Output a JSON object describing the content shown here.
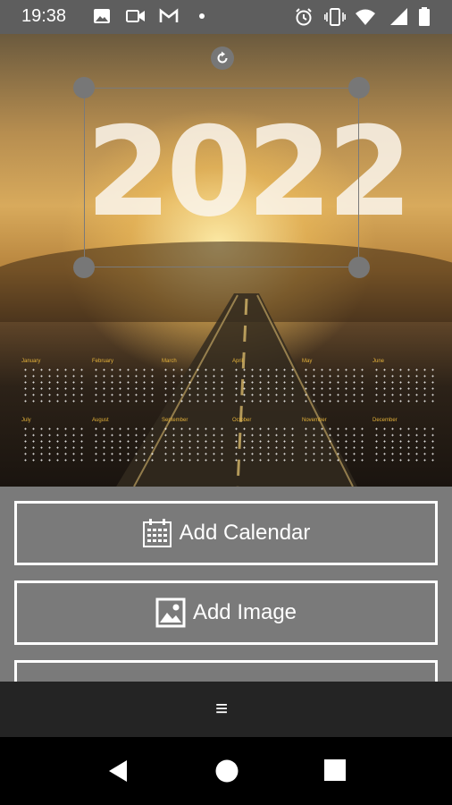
{
  "status_bar": {
    "time": "19:38",
    "icons": [
      "image-icon",
      "video-icon",
      "gmail-icon",
      "dot-icon",
      "alarm-icon",
      "vibrate-icon",
      "wifi-icon",
      "signal-icon",
      "battery-icon"
    ]
  },
  "canvas": {
    "year_text": "2022",
    "months": [
      "January",
      "February",
      "March",
      "April",
      "May",
      "June",
      "July",
      "August",
      "September",
      "October",
      "November",
      "December"
    ]
  },
  "buttons": {
    "add_calendar": "Add Calendar",
    "add_image": "Add Image"
  },
  "bottom_bar": {
    "menu": "≡"
  },
  "colors": {
    "panel": "#7a7a7a",
    "status_bar": "#5e5e5e",
    "bottom_bar": "#242424",
    "month_label": "#e4b23a"
  }
}
